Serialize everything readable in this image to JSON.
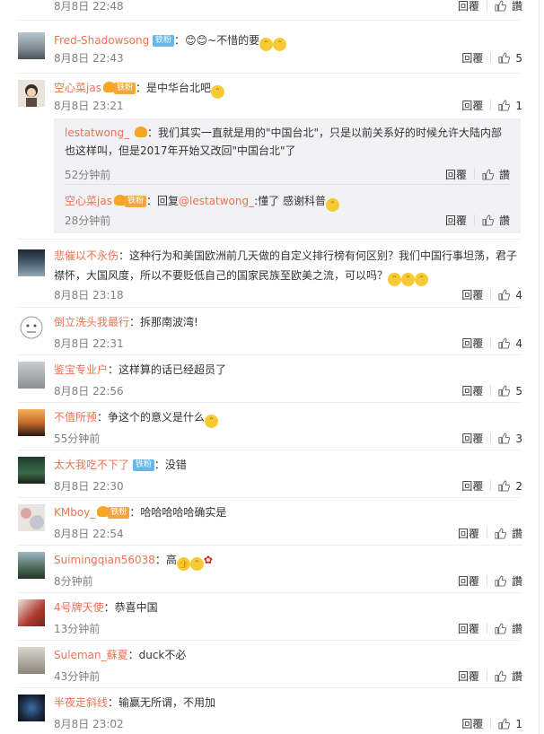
{
  "top": {
    "time": "8月8日 22:48",
    "reply": "回覆",
    "likes": "讚"
  },
  "comments": [
    {
      "user": "Fred-Shadowsong",
      "badge": "铁粉",
      "colon": "：",
      "text": "😊😊~不惜的要",
      "time": "8月8日 22:43",
      "reply": "回覆",
      "likes": "5"
    },
    {
      "user": "空心菜jas",
      "badge": "铁粉",
      "colon": "：",
      "text": "是中华台北吧",
      "time": "8月8日 23:21",
      "reply": "回覆",
      "likes": "1"
    },
    {
      "user": "悲催以不永伤",
      "colon": "：",
      "text": "这种行为和美国欧洲前几天做的自定义排行榜有何区别？我们中国行事坦荡，君子襟怀，大国风度，所以不要贬低自己的国家民族至欧美之流，可以吗？",
      "time": "8月8日 23:18",
      "reply": "回覆",
      "likes": "4"
    },
    {
      "user": "倒立洗头我最行",
      "colon": "：",
      "text": "拆那南波湾!",
      "time": "8月8日 22:31",
      "reply": "回覆",
      "likes": "4"
    },
    {
      "user": "鉴宝专业户",
      "colon": "：",
      "text": "这样算的话已经超员了",
      "time": "8月8日 22:56",
      "reply": "回覆",
      "likes": "5"
    },
    {
      "user": "不值所预",
      "colon": "：",
      "text": "争这个的意义是什么",
      "time": "55分钟前",
      "reply": "回覆",
      "likes": "3"
    },
    {
      "user": "太大我吃不下了",
      "badge": "铁粉",
      "colon": "：",
      "text": "没错",
      "time": "8月8日 22:30",
      "reply": "回覆",
      "likes": "2"
    },
    {
      "user": "KMboy_",
      "badge": "铁粉",
      "colon": "：",
      "text": "哈哈哈哈哈确实是",
      "time": "8月8日 22:54",
      "reply": "回覆",
      "likes": "讚"
    },
    {
      "user": "Suimingqian56038",
      "colon": "：",
      "text": "高",
      "time": "8分钟前",
      "reply": "回覆",
      "likes": "讚"
    },
    {
      "user": "4号牌天使",
      "colon": "：",
      "text": "恭喜中国",
      "time": "13分钟前",
      "reply": "回覆",
      "likes": "讚"
    },
    {
      "user": "Suleman_蘇夏",
      "colon": "：",
      "text": "duck不必",
      "time": "43分钟前",
      "reply": "回覆",
      "likes": "讚"
    },
    {
      "user": "半夜走斜线",
      "colon": "：",
      "text": "输赢无所谓，不用加",
      "time": "8月8日 23:02",
      "reply": "回覆",
      "likes": "1"
    }
  ],
  "subs": [
    {
      "user": "lestatwong_",
      "colon": "：",
      "text": "我们其实一直就是用的\"中国台北\"，只是以前关系好的时候允许大陆内部也这样叫，但是2017年开始又改回\"中国台北\"了",
      "time": "52分钟前",
      "reply": "回覆",
      "likes": "讚"
    },
    {
      "user": "空心菜jas",
      "badge": "铁粉",
      "colon": "：",
      "prefix": "回复",
      "mention": "@lestatwong_",
      "text": ":懂了 感谢科普",
      "time": "28分钟前",
      "reply": "回覆",
      "likes": "讚"
    }
  ],
  "colors": {
    "name": "#eb7350",
    "time": "#808080",
    "sub_bg": "#f2f2f5"
  }
}
